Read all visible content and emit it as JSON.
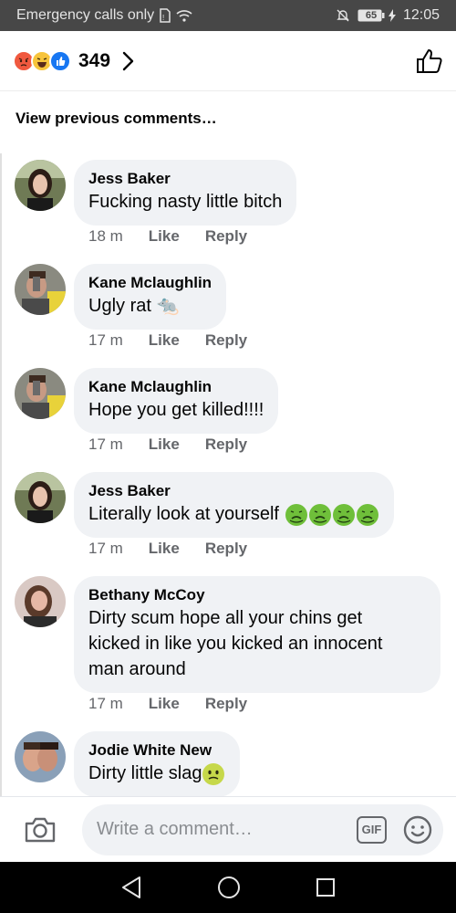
{
  "status_bar": {
    "carrier": "Emergency calls only",
    "battery": "65",
    "time": "12:05"
  },
  "header": {
    "reaction_count": "349",
    "reaction_icons": [
      "angry-reaction-icon",
      "haha-reaction-icon",
      "like-reaction-icon"
    ]
  },
  "view_previous": "View previous comments…",
  "comments": [
    {
      "name": "Jess Baker",
      "text": "Fucking nasty little bitch",
      "time": "18 m",
      "like": "Like",
      "reply": "Reply"
    },
    {
      "name": "Kane Mclaughlin",
      "text": "Ugly rat",
      "emoji": "🐀",
      "time": "17 m",
      "like": "Like",
      "reply": "Reply"
    },
    {
      "name": "Kane Mclaughlin",
      "text": "Hope you get killed!!!!",
      "time": "17 m",
      "like": "Like",
      "reply": "Reply"
    },
    {
      "name": "Jess Baker",
      "text": "Literally look at yourself",
      "emoji_names": [
        "nauseated-face-icon",
        "nauseated-face-icon",
        "nauseated-face-icon",
        "nauseated-face-icon"
      ],
      "time": "17 m",
      "like": "Like",
      "reply": "Reply"
    },
    {
      "name": "Bethany McCoy",
      "text_lines": [
        "Dirty scum hope all your chins get",
        "kicked in like you kicked an innocent",
        "man around"
      ],
      "time": "17 m",
      "like": "Like",
      "reply": "Reply"
    },
    {
      "name": "Jodie White New",
      "text": "Dirty little slag",
      "emoji_name": "woozy-face-icon"
    }
  ],
  "composer": {
    "placeholder": "Write a comment…",
    "gif_label": "GIF"
  },
  "colors": {
    "bubble": "#f0f2f5",
    "meta": "#65676b",
    "status_bar": "#474747",
    "like_blue": "#1877f2"
  }
}
